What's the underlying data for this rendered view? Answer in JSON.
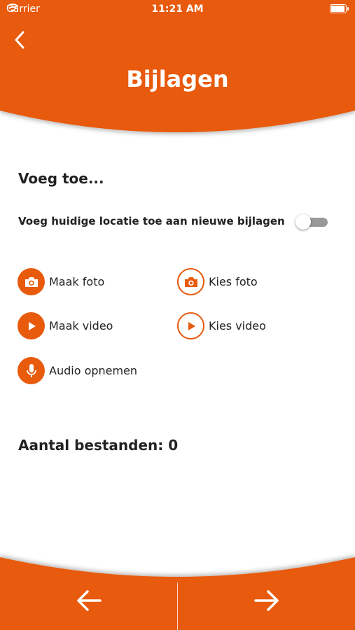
{
  "status_bar": {
    "carrier": "Carrier",
    "time": "11:21 AM"
  },
  "header": {
    "title": "Bijlagen"
  },
  "section": {
    "title": "Voeg toe..."
  },
  "location_option": {
    "label": "Voeg huidige locatie toe aan nieuwe bijlagen",
    "enabled": false
  },
  "actions": {
    "take_photo": "Maak foto",
    "choose_photo": "Kies foto",
    "take_video": "Maak video",
    "choose_video": "Kies video",
    "record_audio": "Audio opnemen"
  },
  "file_count": {
    "label": "Aantal bestanden: 0"
  },
  "colors": {
    "accent": "#e85a0c",
    "toggle_track": "#999999",
    "text": "#222222",
    "background": "#ffffff"
  }
}
